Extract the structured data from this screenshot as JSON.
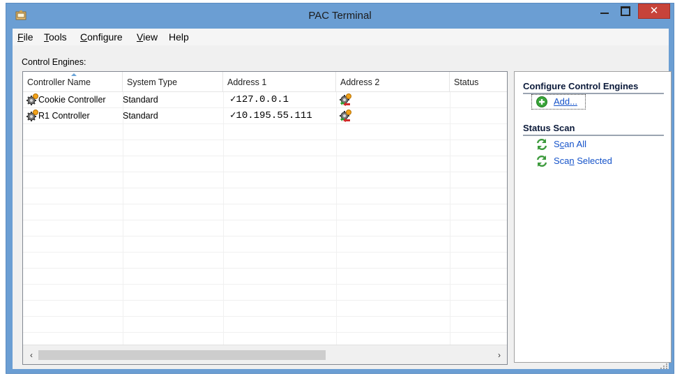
{
  "window": {
    "title": "PAC Terminal",
    "close_glyph": "✕"
  },
  "menu": [
    {
      "label": "File",
      "mnemonic": "F",
      "rest": "ile"
    },
    {
      "label": "Tools",
      "mnemonic": "T",
      "rest": "ools"
    },
    {
      "label": "Configure",
      "mnemonic": "C",
      "rest": "onfigure"
    },
    {
      "label": "View",
      "mnemonic": "V",
      "rest": "iew"
    },
    {
      "label": "Help",
      "mnemonic": "",
      "rest": "Help"
    }
  ],
  "control_engines": {
    "label": "Control Engines:",
    "columns": [
      "Controller Name",
      "System Type",
      "Address 1",
      "Address 2",
      "Status"
    ],
    "sorted_column": "Controller Name",
    "rows": [
      {
        "name": "Cookie Controller",
        "system_type": "Standard",
        "address1": "✓127.0.0.1",
        "address2_icon": "controller-warning-icon",
        "status": ""
      },
      {
        "name": "R1 Controller",
        "system_type": "Standard",
        "address1": "✓10.195.55.111",
        "address2_icon": "controller-warning-icon",
        "status": ""
      }
    ]
  },
  "side_panel": {
    "configure_heading": "Configure Control Engines",
    "add_label": "Add...",
    "status_heading": "Status Scan",
    "scan_all": {
      "pre": "S",
      "mn": "c",
      "post": "an All"
    },
    "scan_selected": {
      "pre": "Sca",
      "mn": "n",
      "post": " Selected"
    }
  },
  "scrollbar": {
    "left_arrow": "‹",
    "right_arrow": "›"
  },
  "colors": {
    "title_bar": "#6b9ed3",
    "close_button": "#c7433a",
    "link": "#1452c9",
    "add_icon": "#3aa53a"
  }
}
